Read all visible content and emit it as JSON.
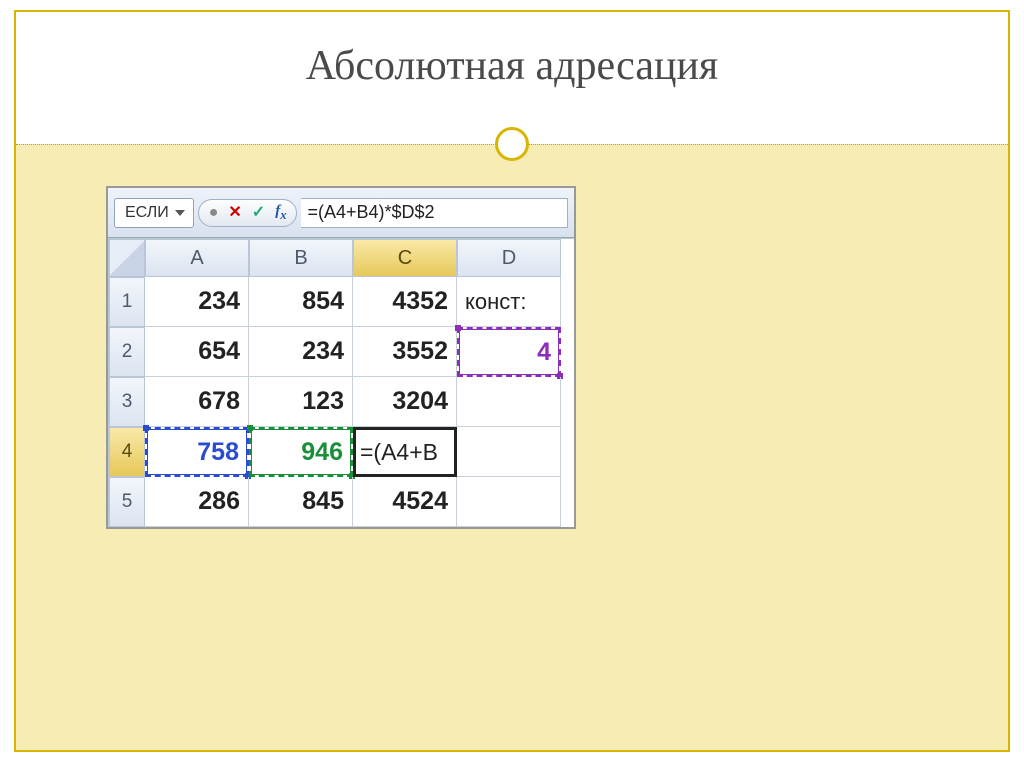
{
  "slide": {
    "title": "Абсолютная адресация"
  },
  "excel": {
    "namebox": "ЕСЛИ",
    "formula": "=(A4+B4)*$D$2",
    "columns": [
      "A",
      "B",
      "C",
      "D"
    ],
    "active_column": "C",
    "active_row": "4",
    "row_numbers": [
      "1",
      "2",
      "3",
      "4",
      "5"
    ],
    "cells": {
      "r1": {
        "A": "234",
        "B": "854",
        "C": "4352",
        "D": "конст:"
      },
      "r2": {
        "A": "654",
        "B": "234",
        "C": "3552",
        "D": "4"
      },
      "r3": {
        "A": "678",
        "B": "123",
        "C": "3204",
        "D": ""
      },
      "r4": {
        "A": "758",
        "B": "946",
        "C": "=(A4+B",
        "D": ""
      },
      "r5": {
        "A": "286",
        "B": "845",
        "C": "4524",
        "D": ""
      }
    }
  }
}
